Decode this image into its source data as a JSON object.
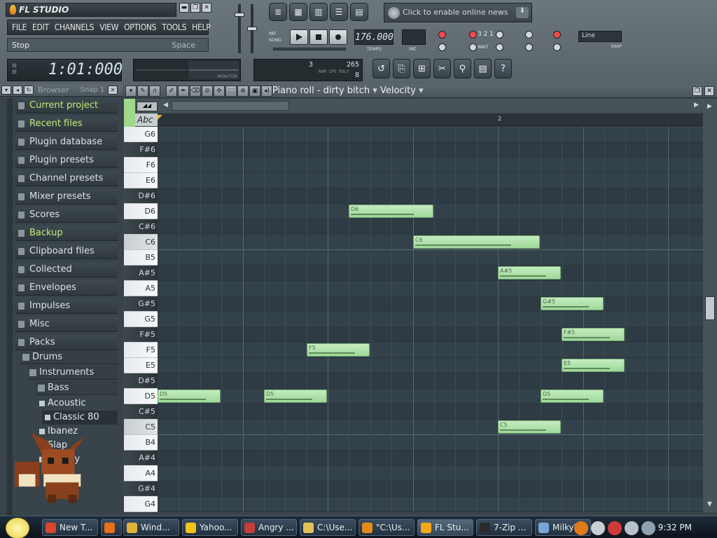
{
  "app": {
    "title": "FL STUDIO",
    "menu": [
      "FILE",
      "EDIT",
      "CHANNELS",
      "VIEW",
      "OPTIONS",
      "TOOLS",
      "HELP"
    ],
    "hint": "Stop",
    "hint_shortcut": "Space",
    "song_time": "1:01:000",
    "news": "Click to enable online news",
    "monitor_label": "MONITOR",
    "cpu": {
      "val1": "3",
      "val2": "265",
      "val3": "8",
      "labels": "RAM CPU POLY"
    }
  },
  "transport": {
    "pat_label": "PAT",
    "song_label": "SONG",
    "tempo": "176.000",
    "tempo_label": "TEMPO",
    "pat_short": "PAT",
    "wait_label": "WAIT",
    "counter_label": "3 2 1",
    "snap_value": "Line",
    "snap_label": "SNAP"
  },
  "browser": {
    "title": "Browser",
    "snap": "Snap 1",
    "items": [
      {
        "label": "Current project",
        "open": true
      },
      {
        "label": "Recent files",
        "open": true
      },
      {
        "label": "Plugin database",
        "open": false
      },
      {
        "label": "Plugin presets",
        "open": false
      },
      {
        "label": "Channel presets",
        "open": false
      },
      {
        "label": "Mixer presets",
        "open": false
      },
      {
        "label": "Scores",
        "open": false
      },
      {
        "label": "Backup",
        "open": true
      },
      {
        "label": "Clipboard files",
        "open": false
      },
      {
        "label": "Collected",
        "open": false
      },
      {
        "label": "Envelopes",
        "open": false
      },
      {
        "label": "Impulses",
        "open": false
      },
      {
        "label": "Misc",
        "open": false
      },
      {
        "label": "Packs",
        "open": false
      }
    ],
    "packs": [
      "Drums",
      "Instruments",
      "Bass"
    ],
    "bass_presets": [
      "Acoustic",
      "Classic 80",
      "Ibanez",
      "Slap",
      "Legacy"
    ],
    "selected_preset": "Classic 80"
  },
  "piano_roll": {
    "title": "Piano roll - dirty bitch",
    "param": "Velocity",
    "keyboard_mode": "Abc",
    "bar_marker": "2",
    "keys": [
      "G6",
      "F#6",
      "F6",
      "E6",
      "D#6",
      "D6",
      "C#6",
      "C6",
      "B5",
      "A#5",
      "A5",
      "G#5",
      "G5",
      "F#5",
      "F5",
      "E5",
      "D#5",
      "D5",
      "C#5",
      "C5",
      "B4",
      "A#4",
      "A4",
      "G#4",
      "G4"
    ],
    "notes": [
      {
        "pitch": "D6",
        "start": 2.25,
        "length": 1.0,
        "velocity": 0.78
      },
      {
        "pitch": "C6",
        "start": 3.0,
        "length": 1.5,
        "velocity": 0.78
      },
      {
        "pitch": "A#5",
        "start": 4.0,
        "length": 0.75,
        "velocity": 0.78
      },
      {
        "pitch": "G#5",
        "start": 4.5,
        "length": 0.75,
        "velocity": 0.78
      },
      {
        "pitch": "F#5",
        "start": 4.75,
        "length": 0.75,
        "velocity": 0.78
      },
      {
        "pitch": "F5",
        "start": 1.75,
        "length": 0.75,
        "velocity": 0.78
      },
      {
        "pitch": "E5",
        "start": 4.75,
        "length": 0.75,
        "velocity": 0.78
      },
      {
        "pitch": "D5",
        "start": 0.0,
        "length": 0.75,
        "velocity": 0.78
      },
      {
        "pitch": "D5",
        "start": 1.25,
        "length": 0.75,
        "velocity": 0.78
      },
      {
        "pitch": "D5",
        "start": 4.5,
        "length": 0.75,
        "velocity": 0.78
      },
      {
        "pitch": "C5",
        "start": 4.0,
        "length": 0.75,
        "velocity": 0.78
      }
    ]
  },
  "taskbar": {
    "items": [
      {
        "label": "New T...",
        "color": "#d9462c"
      },
      {
        "label": "",
        "color": "#e8701a"
      },
      {
        "label": "Wind...",
        "color": "#e0b23a"
      },
      {
        "label": "Yahoo...",
        "color": "#f0c21c"
      },
      {
        "label": "Angry ...",
        "color": "#c43c3c"
      },
      {
        "label": "C:\\Use...",
        "color": "#e4c05a"
      },
      {
        "label": "\"C:\\Us...",
        "color": "#e48a1a"
      },
      {
        "label": "FL Stu...",
        "color": "#f3a81c"
      },
      {
        "label": "7-Zip ...",
        "color": "#2b2b2b"
      },
      {
        "label": "MilkyT...",
        "color": "#7aa4d8"
      }
    ],
    "clock": "9:32 PM"
  }
}
